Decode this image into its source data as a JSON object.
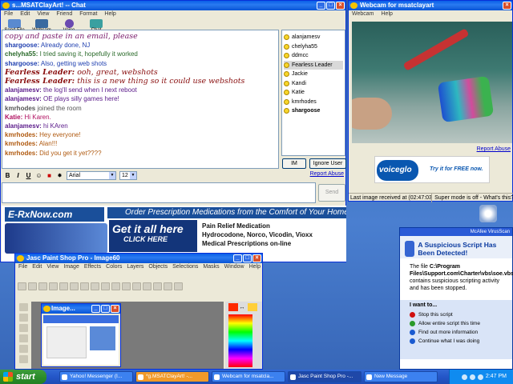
{
  "chat": {
    "title": "s...MSATClayArt! -- Chat",
    "menu": [
      "File",
      "Edit",
      "View",
      "Friend",
      "Format",
      "Help"
    ],
    "toolbar": [
      "Send File",
      "Webcam",
      "Voice",
      "Chat"
    ],
    "messages": [
      {
        "who": "",
        "text": "copy and paste in an email, please",
        "color": "#7a1a6a",
        "style": "cursive"
      },
      {
        "who": "shargoose:",
        "text": " Already done, NJ",
        "color": "#2040b0"
      },
      {
        "who": "chelyha55:",
        "text": " I tried saving it, hopefully it worked",
        "color": "#2a6a2a"
      },
      {
        "who": "shargoose:",
        "text": " Also, getting web shots",
        "color": "#2040b0"
      },
      {
        "who": "Fearless Leader:",
        "text": " ooh, great, webshots",
        "color": "#8a1010",
        "style": "cursive"
      },
      {
        "who": "Fearless Leader:",
        "text": " this is a new thing so it could use webshots",
        "color": "#8a1010",
        "style": "cursive"
      },
      {
        "who": "alanjamesv:",
        "text": " the log'll send when I next reboot",
        "color": "#5a1a8a"
      },
      {
        "who": "alanjamesv:",
        "text": " OE plays silly games here!",
        "color": "#5a1a8a"
      },
      {
        "who": "kmrhodes",
        "text": " joined the room",
        "color": "#555555"
      },
      {
        "who": "Katie:",
        "text": " Hi Karen.",
        "color": "#b01060"
      },
      {
        "who": "alanjamesv:",
        "text": " hi KAren",
        "color": "#5a1a8a"
      },
      {
        "who": "kmrhodes:",
        "text": " Hey everyone!",
        "color": "#b05a10"
      },
      {
        "who": "kmrhodes:",
        "text": " Alan!!!",
        "color": "#b05a10"
      },
      {
        "who": "kmrhodes:",
        "text": " Did you get it yet????",
        "color": "#b05a10"
      }
    ],
    "users": [
      "alanjamesv",
      "chelyha55",
      "ddmcc",
      "Fearless Leader",
      "Jackie",
      "Kandi",
      "Katie",
      "kmrhodes",
      "shargoose"
    ],
    "im_label": "IM",
    "ignore_label": "Ignore User",
    "format": {
      "bold": "B",
      "italic": "I",
      "underline": "U",
      "font": "Arial",
      "size": "12"
    },
    "report_abuse": "Report Abuse",
    "send_label": "Send",
    "ad": {
      "logo": "E-RxNow.com",
      "tagline": "Order Prescription Medications from the Comfort of Your Home",
      "cta1": "Get it all here",
      "cta2": "CLICK HERE",
      "lines": [
        "Pain Relief Medication",
        "Hydrocodone, Norco, Vicodin, Vioxx",
        "Medical Prescriptions on-line"
      ]
    }
  },
  "webcam": {
    "title": "Webcam for msatclayart",
    "menu": [
      "Webcam",
      "Help"
    ],
    "report_abuse": "Report Abuse",
    "banner_logo": "voiceglo",
    "banner_text": "Try it for FREE now.",
    "status_left": "Last image received at (02:47:03 PM)",
    "status_right": "Super mode is off - What's this?"
  },
  "mcafee": {
    "header": "McAfee VirusScan",
    "title": "A Suspicious Script Has Been Detected!",
    "body_pre": "The file ",
    "file": "C:\\Program Files\\Support.com\\Charter\\vbs\\soe.vbs",
    "body_post": " contains suspicious scripting activity and has been stopped.",
    "iwant": "I want to...",
    "options": [
      {
        "label": "Stop this script",
        "color": "#d01010"
      },
      {
        "label": "Allow entire script this time",
        "color": "#2a9a2a"
      },
      {
        "label": "Find out more information",
        "color": "#1a5ad0"
      },
      {
        "label": "Continue what I was doing",
        "color": "#1a5ad0"
      }
    ]
  },
  "psp": {
    "title": "Jasc Paint Shop Pro - Image60",
    "menu": [
      "File",
      "Edit",
      "View",
      "Image",
      "Effects",
      "Colors",
      "Layers",
      "Objects",
      "Selections",
      "Masks",
      "Window",
      "Help"
    ],
    "image_title": "Image...",
    "swap_symbol": "↔"
  },
  "taskbar": {
    "start": "start",
    "tasks": [
      "Yahoo! Messenger (I...",
      "*g.MSATClayArt! -...",
      "Webcam for msatcla...",
      "Jasc Paint Shop Pro -...",
      "New Message"
    ],
    "clock": "2:47 PM"
  }
}
